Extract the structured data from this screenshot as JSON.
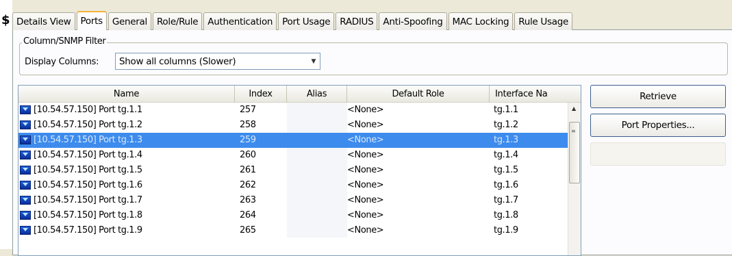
{
  "tabs": [
    "Details View",
    "Ports",
    "General",
    "Role/Rule",
    "Authentication",
    "Port Usage",
    "RADIUS",
    "Anti-Spoofing",
    "MAC Locking",
    "Rule Usage"
  ],
  "active_tab": "Ports",
  "filter": {
    "group_title": "Column/SNMP Filter",
    "display_columns_label": "Display Columns:",
    "display_columns_value": "Show all columns (Slower)"
  },
  "table": {
    "headers": {
      "name": "Name",
      "index": "Index",
      "alias": "Alias",
      "default_role": "Default Role",
      "interface": "Interface Na"
    },
    "rows": [
      {
        "name": "[10.54.57.150] Port tg.1.1",
        "index": "257",
        "alias": "",
        "default_role": "<None>",
        "interface": "tg.1.1"
      },
      {
        "name": "[10.54.57.150] Port tg.1.2",
        "index": "258",
        "alias": "",
        "default_role": "<None>",
        "interface": "tg.1.2"
      },
      {
        "name": "[10.54.57.150] Port tg.1.3",
        "index": "259",
        "alias": "",
        "default_role": "<None>",
        "interface": "tg.1.3",
        "selected": true
      },
      {
        "name": "[10.54.57.150] Port tg.1.4",
        "index": "260",
        "alias": "",
        "default_role": "<None>",
        "interface": "tg.1.4"
      },
      {
        "name": "[10.54.57.150] Port tg.1.5",
        "index": "261",
        "alias": "",
        "default_role": "<None>",
        "interface": "tg.1.5"
      },
      {
        "name": "[10.54.57.150] Port tg.1.6",
        "index": "262",
        "alias": "",
        "default_role": "<None>",
        "interface": "tg.1.6"
      },
      {
        "name": "[10.54.57.150] Port tg.1.7",
        "index": "263",
        "alias": "",
        "default_role": "<None>",
        "interface": "tg.1.7"
      },
      {
        "name": "[10.54.57.150] Port tg.1.8",
        "index": "264",
        "alias": "",
        "default_role": "<None>",
        "interface": "tg.1.8"
      },
      {
        "name": "[10.54.57.150] Port tg.1.9",
        "index": "265",
        "alias": "",
        "default_role": "<None>",
        "interface": "tg.1.9"
      }
    ]
  },
  "buttons": {
    "retrieve": "Retrieve",
    "port_properties": "Port Properties..."
  },
  "colors": {
    "selection": "#3d8bed",
    "active_tab_accent": "#f5b13a",
    "port_icon": "#1f5fd8"
  },
  "icons": {
    "row_icon": "port-icon"
  }
}
